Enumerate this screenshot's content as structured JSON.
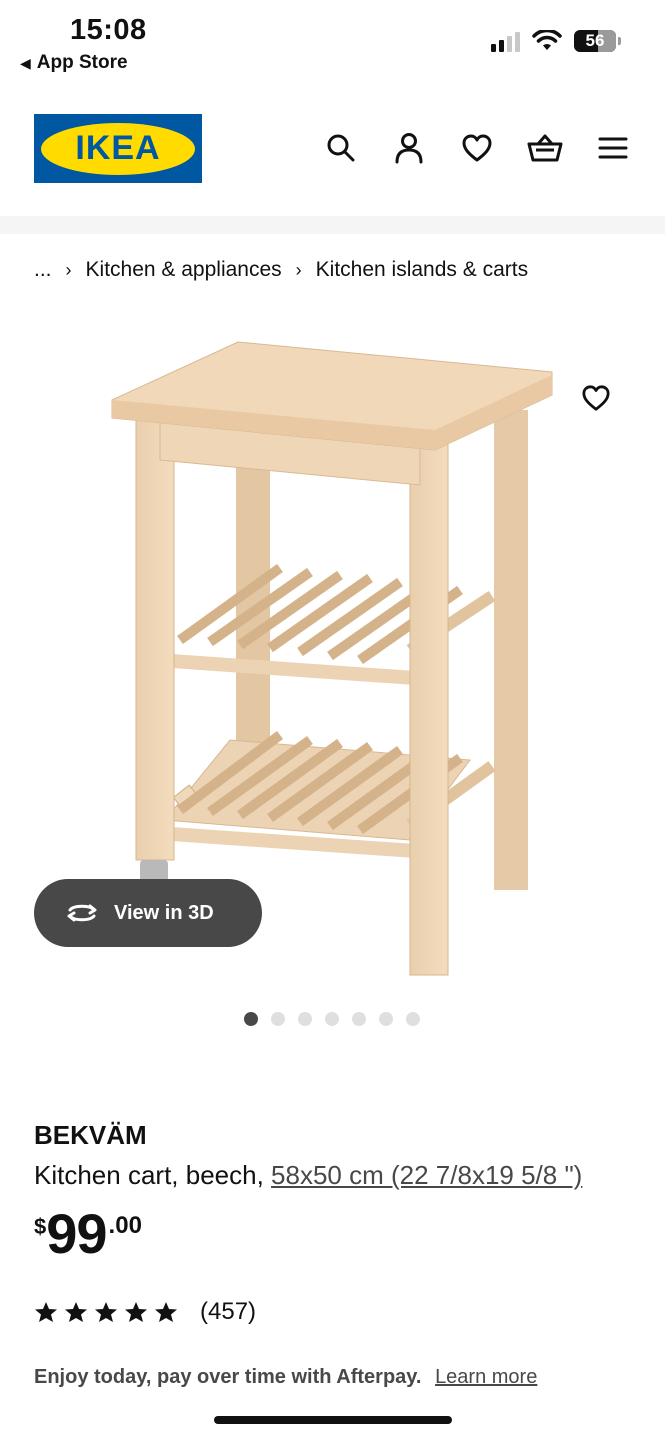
{
  "status_bar": {
    "time": "15:08",
    "back_label": "App Store",
    "battery": "56"
  },
  "header": {
    "logo_text": "IKEA",
    "icons": [
      "search-icon",
      "profile-icon",
      "heart-icon",
      "basket-icon",
      "menu-icon"
    ]
  },
  "breadcrumb": {
    "items": [
      "...",
      "Kitchen & appliances",
      "Kitchen islands & carts"
    ]
  },
  "gallery": {
    "view_3d_label": "View in 3D",
    "dot_count": 7,
    "active_index": 0
  },
  "product": {
    "name": "BEKVÄM",
    "description": "Kitchen cart, beech,",
    "measurements": "58x50 cm (22 7/8x19 5/8 \")",
    "price_currency": "$",
    "price_integer": "99",
    "price_decimal": ".00",
    "rating": 5,
    "rating_count": "(457)",
    "afterpay_text": "Enjoy today, pay over time with Afterpay.",
    "afterpay_link": "Learn more"
  },
  "colors": {
    "ikea_blue": "#0058a3",
    "ikea_yellow": "#ffdb00",
    "button_dark": "#484848"
  }
}
